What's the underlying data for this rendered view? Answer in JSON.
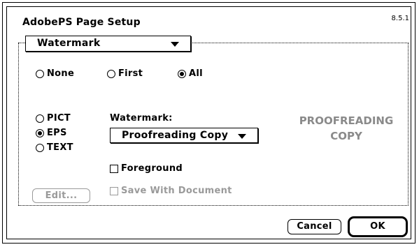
{
  "dialog": {
    "title": "AdobePS Page Setup",
    "version": "8.5.1"
  },
  "panel_popup": {
    "selected": "Watermark"
  },
  "scope_radios": [
    {
      "label": "None",
      "selected": false
    },
    {
      "label": "First",
      "selected": false
    },
    {
      "label": "All",
      "selected": true
    }
  ],
  "format_radios": [
    {
      "label": "PICT",
      "selected": false
    },
    {
      "label": "EPS",
      "selected": true
    },
    {
      "label": "TEXT",
      "selected": false
    }
  ],
  "watermark": {
    "label": "Watermark:",
    "selected": "Proofreading Copy"
  },
  "preview": {
    "line1": "PROOFREADING",
    "line2": "COPY"
  },
  "foreground": {
    "label": "Foreground",
    "checked": false
  },
  "save_with_document": {
    "label": "Save With Document",
    "checked": false,
    "enabled": false
  },
  "buttons": {
    "edit": "Edit...",
    "cancel": "Cancel",
    "ok": "OK"
  }
}
